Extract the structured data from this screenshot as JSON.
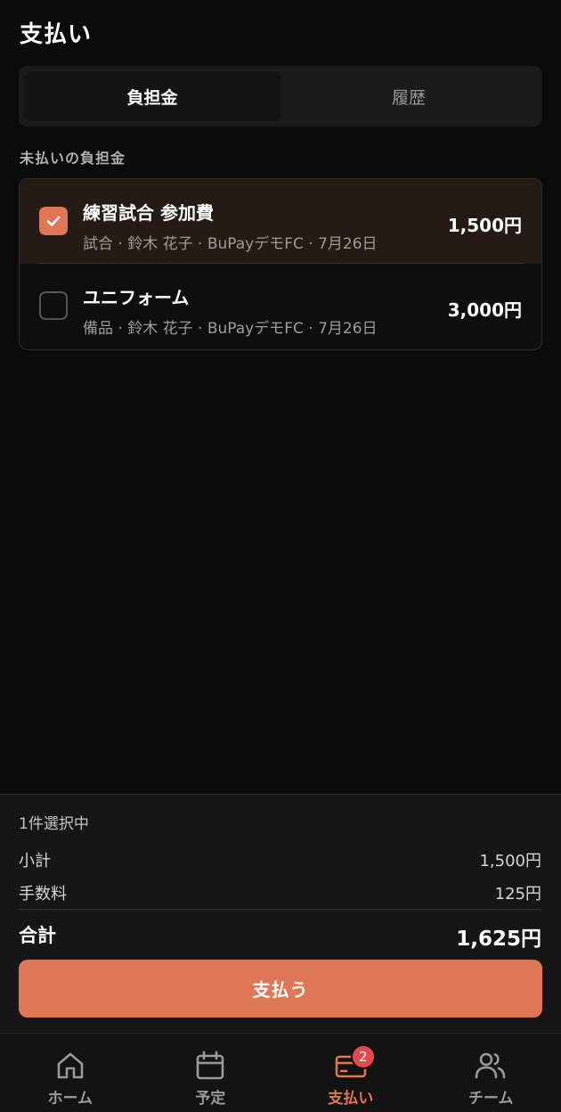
{
  "header": {
    "title": "支払い"
  },
  "segments": [
    {
      "label": "負担金",
      "active": true
    },
    {
      "label": "履歴",
      "active": false
    }
  ],
  "section_label": "未払いの負担金",
  "items": [
    {
      "title": "練習試合 参加費",
      "subtitle": "試合 · 鈴木 花子 · BuPayデモFC · 7月26日",
      "amount": "1,500円",
      "checked": true
    },
    {
      "title": "ユニフォーム",
      "subtitle": "備品 · 鈴木 花子 · BuPayデモFC · 7月26日",
      "amount": "3,000円",
      "checked": false
    }
  ],
  "summary": {
    "selected_count": "1件選択中",
    "subtotal_label": "小計",
    "subtotal_value": "1,500円",
    "fee_label": "手数料",
    "fee_value": "125円",
    "total_label": "合計",
    "total_value": "1,625円",
    "pay_button": "支払う"
  },
  "tabbar": {
    "items": [
      {
        "label": "ホーム",
        "icon": "home-icon"
      },
      {
        "label": "予定",
        "icon": "calendar-icon"
      },
      {
        "label": "支払い",
        "icon": "card-icon",
        "badge": "2",
        "active": true
      },
      {
        "label": "チーム",
        "icon": "users-icon"
      }
    ]
  },
  "colors": {
    "accent": "#df7656",
    "badge": "#e5484d",
    "background": "#0b0b0b"
  }
}
